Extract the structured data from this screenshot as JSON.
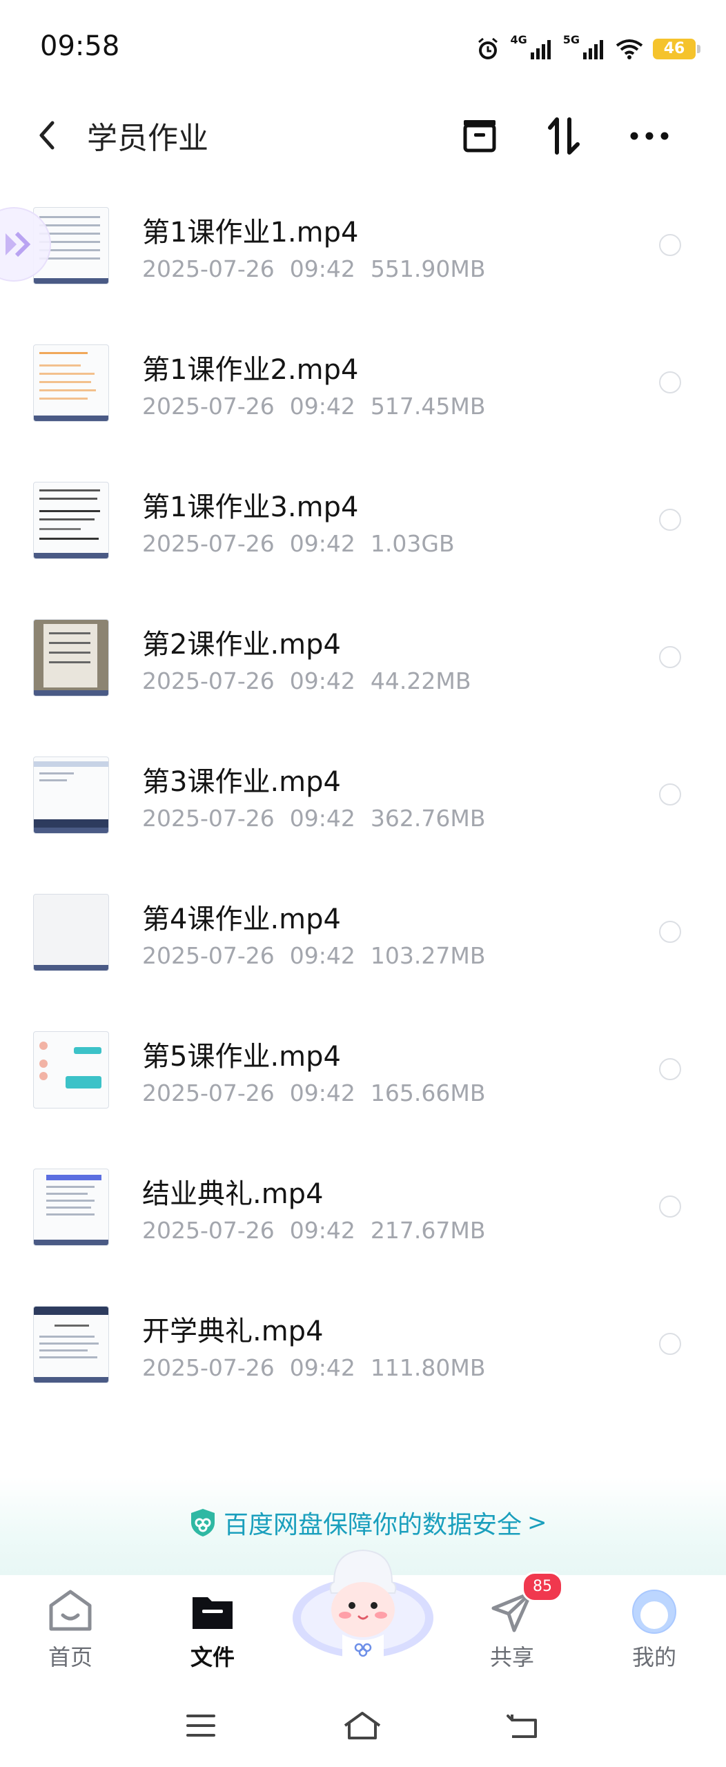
{
  "status_bar": {
    "time": "09:58",
    "network1": "4G",
    "network2": "5G",
    "battery": "46"
  },
  "header": {
    "title": "学员作业",
    "icons": [
      "back-arrow-icon",
      "select-box-icon",
      "sort-icon",
      "more-icon"
    ]
  },
  "files": [
    {
      "name": "第1课作业1.mp4",
      "date": "2025-07-26",
      "time": "09:42",
      "size": "551.90MB"
    },
    {
      "name": "第1课作业2.mp4",
      "date": "2025-07-26",
      "time": "09:42",
      "size": "517.45MB"
    },
    {
      "name": "第1课作业3.mp4",
      "date": "2025-07-26",
      "time": "09:42",
      "size": "1.03GB"
    },
    {
      "name": "第2课作业.mp4",
      "date": "2025-07-26",
      "time": "09:42",
      "size": "44.22MB"
    },
    {
      "name": "第3课作业.mp4",
      "date": "2025-07-26",
      "time": "09:42",
      "size": "362.76MB"
    },
    {
      "name": "第4课作业.mp4",
      "date": "2025-07-26",
      "time": "09:42",
      "size": "103.27MB"
    },
    {
      "name": "第5课作业.mp4",
      "date": "2025-07-26",
      "time": "09:42",
      "size": "165.66MB"
    },
    {
      "name": "结业典礼.mp4",
      "date": "2025-07-26",
      "time": "09:42",
      "size": "217.67MB"
    },
    {
      "name": "开学典礼.mp4",
      "date": "2025-07-26",
      "time": "09:42",
      "size": "111.80MB"
    }
  ],
  "banner": {
    "text": "百度网盘保障你的数据安全",
    "chevron": ">"
  },
  "tabs": [
    {
      "label": "首页",
      "icon": "home-icon"
    },
    {
      "label": "文件",
      "icon": "folder-icon",
      "active": true
    },
    {
      "label": "共享",
      "icon": "paper-plane-icon",
      "badge": "85"
    },
    {
      "label": "我的",
      "icon": "avatar-icon"
    }
  ],
  "colors": {
    "accent": "#1a9fbd",
    "badge": "#f0384e",
    "meta_text": "#a3a6ad"
  }
}
